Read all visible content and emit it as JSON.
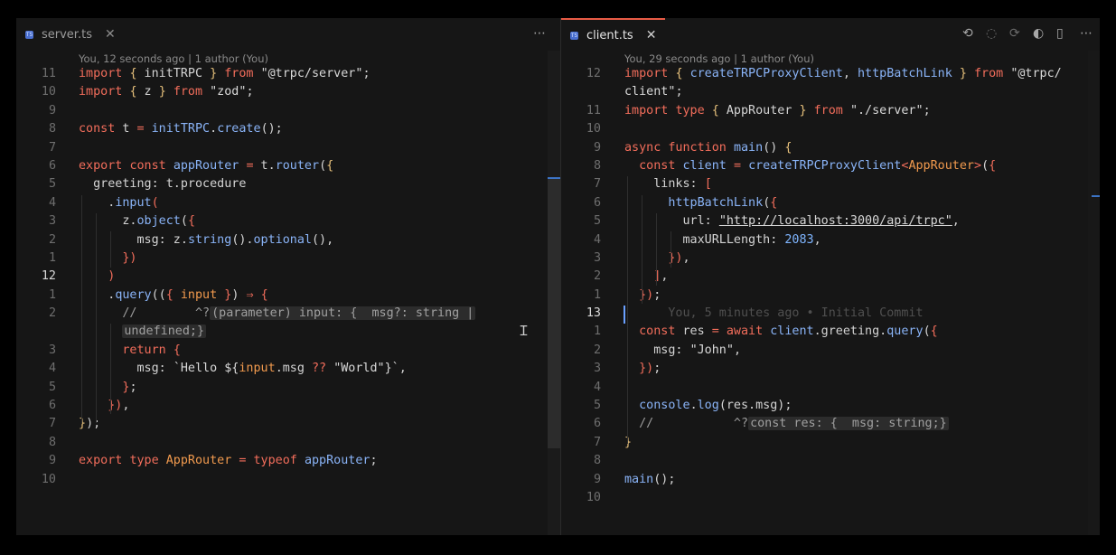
{
  "left": {
    "tab": {
      "label": "server.ts",
      "icon": "ts"
    },
    "blame": "You, 12 seconds ago | 1 author (You)",
    "lines": [
      {
        "n": "11",
        "html": "<span class='kw'>import</span> <span class='br1'>{</span> initTRPC <span class='br1'>}</span> <span class='kw'>from</span> <span class='str'>\"@trpc/server\"</span>;"
      },
      {
        "n": "10",
        "html": "<span class='kw'>import</span> <span class='br1'>{</span> z <span class='br1'>}</span> <span class='kw'>from</span> <span class='str'>\"zod\"</span>;"
      },
      {
        "n": "9",
        "html": ""
      },
      {
        "n": "8",
        "html": "<span class='kw'>const</span> t <span class='kw'>=</span> <span class='fn'>initTRPC</span>.<span class='fn'>create</span>();"
      },
      {
        "n": "7",
        "html": ""
      },
      {
        "n": "6",
        "html": "<span class='kw'>export</span> <span class='kw'>const</span> <span class='fn'>appRouter</span> <span class='kw'>=</span> t.<span class='fn'>router</span>(<span class='br1'>{</span>"
      },
      {
        "n": "5",
        "html": "  greeting: t.procedure"
      },
      {
        "n": "4",
        "html": "    .<span class='fn'>input</span><span class='kw'>(</span>"
      },
      {
        "n": "3",
        "html": "      z.<span class='fn'>object</span>(<span class='kw'>{</span>"
      },
      {
        "n": "2",
        "html": "        msg: z.<span class='fn'>string</span>().<span class='fn'>optional</span>(),"
      },
      {
        "n": "1",
        "html": "      <span class='kw'>})</span>"
      },
      {
        "n": "12",
        "cur": true,
        "html": "    <span class='kw'>)</span>"
      },
      {
        "n": "1",
        "html": "    .<span class='fn'>query</span>((<span class='kw'>{</span> <span class='ty'>input</span> <span class='kw'>}</span>) <span class='kw'>⇒</span> <span class='kw'>{</span>"
      },
      {
        "n": "2",
        "html": "      <span class='cm'>//        ^?</span><span class='hint'>(parameter) input: {  msg?: string |</span>"
      },
      {
        "n": "",
        "html": "      <span class='hint'>undefined;}</span>"
      },
      {
        "n": "3",
        "html": "      <span class='kw'>return</span> <span class='kw'>{</span>"
      },
      {
        "n": "4",
        "html": "        msg: <span class='str'>`Hello ${</span><span class='ty'>input</span>.msg <span class='kw'>??</span> <span class='str'>\"World\"</span><span class='str'>}`</span>,"
      },
      {
        "n": "5",
        "html": "      <span class='kw'>}</span>;"
      },
      {
        "n": "6",
        "html": "    <span class='kw'>})</span>,"
      },
      {
        "n": "7",
        "html": "<span class='br1'>}</span>);"
      },
      {
        "n": "8",
        "html": ""
      },
      {
        "n": "9",
        "html": "<span class='kw'>export</span> <span class='kw'>type</span> <span class='ty'>AppRouter</span> <span class='kw'>=</span> <span class='kw'>typeof</span> <span class='fn'>appRouter</span>;"
      },
      {
        "n": "10",
        "html": ""
      }
    ]
  },
  "right": {
    "tab": {
      "label": "client.ts",
      "icon": "ts"
    },
    "blame": "You, 29 seconds ago | 1 author (You)",
    "lines": [
      {
        "n": "12",
        "html": "<span class='kw'>import</span> <span class='br1'>{</span> <span class='fn'>createTRPCProxyClient</span>, <span class='fn'>httpBatchLink</span> <span class='br1'>}</span> <span class='kw'>from</span> <span class='str'>\"@trpc/</span>"
      },
      {
        "n": "",
        "html": "<span class='str'>client\"</span>;"
      },
      {
        "n": "11",
        "html": "<span class='kw'>import</span> <span class='kw'>type</span> <span class='br1'>{</span> AppRouter <span class='br1'>}</span> <span class='kw'>from</span> <span class='str'>\"./server\"</span>;"
      },
      {
        "n": "10",
        "html": ""
      },
      {
        "n": "9",
        "html": "<span class='kw'>async</span> <span class='kw'>function</span> <span class='fn'>main</span>() <span class='br1'>{</span>"
      },
      {
        "n": "8",
        "html": "  <span class='kw'>const</span> <span class='fn'>client</span> <span class='kw'>=</span> <span class='fn'>createTRPCProxyClient</span><span class='kw'>&lt;</span><span class='ty'>AppRouter</span><span class='kw'>&gt;</span>(<span class='kw'>{</span>"
      },
      {
        "n": "7",
        "html": "    links: <span class='kw'>[</span>"
      },
      {
        "n": "6",
        "html": "      <span class='fn'>httpBatchLink</span>(<span class='kw'>{</span>"
      },
      {
        "n": "5",
        "html": "        url: <span class='url'>\"http://localhost:3000/api/trpc\"</span>,"
      },
      {
        "n": "4",
        "html": "        maxURLLength: <span class='num'>2083</span>,"
      },
      {
        "n": "3",
        "html": "      <span class='kw'>})</span>,"
      },
      {
        "n": "2",
        "html": "    <span class='kw'>]</span>,"
      },
      {
        "n": "1",
        "html": "  <span class='kw'>})</span>;"
      },
      {
        "n": "13",
        "cur": true,
        "html": "      <span class='ghost'>You, 5 minutes ago • Initial Commit</span>"
      },
      {
        "n": "1",
        "html": "  <span class='kw'>const</span> res <span class='kw'>=</span> <span class='kw'>await</span> <span class='fn'>client</span>.greeting.<span class='fn'>query</span>(<span class='kw'>{</span>"
      },
      {
        "n": "2",
        "html": "    msg: <span class='str'>\"John\"</span>,"
      },
      {
        "n": "3",
        "html": "  <span class='kw'>})</span>;"
      },
      {
        "n": "4",
        "html": ""
      },
      {
        "n": "5",
        "html": "  <span class='fn'>console</span>.<span class='fn'>log</span>(res.msg);"
      },
      {
        "n": "6",
        "html": "  <span class='cm'>//           ^?</span><span class='hint'>const res: {  msg: string;}</span>"
      },
      {
        "n": "7",
        "html": "<span class='br1'>}</span>"
      },
      {
        "n": "8",
        "html": ""
      },
      {
        "n": "9",
        "html": "<span class='fn'>main</span>();"
      },
      {
        "n": "10",
        "html": ""
      }
    ]
  },
  "toolbar": {
    "icons": [
      "go-back-icon",
      "circle-icon",
      "go-forward-icon",
      "timeline-icon",
      "split-editor-icon",
      "more-actions-icon"
    ]
  }
}
